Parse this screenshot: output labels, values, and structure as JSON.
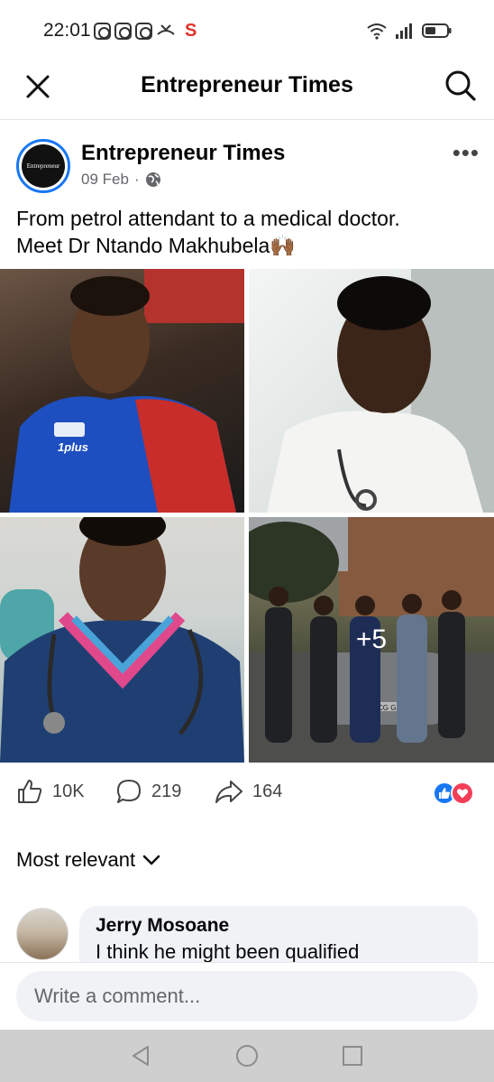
{
  "status_bar": {
    "time": "22:01",
    "left_icons": [
      "instagram-icon",
      "instagram-icon",
      "instagram-icon",
      "missed-call-icon",
      "s-app-icon"
    ],
    "s_label": "S",
    "right_icons": [
      "wifi-icon",
      "signal-icon",
      "battery-icon"
    ]
  },
  "app_bar": {
    "title": "Entrepreneur Times",
    "close_icon": "close-icon",
    "search_icon": "search-icon"
  },
  "post": {
    "page_name": "Entrepreneur Times",
    "avatar_text": "Entrepreneur",
    "date": "09 Feb",
    "separator": "·",
    "privacy_icon": "globe-icon",
    "more_label": "•••",
    "text_line1": "From petrol attendant to a medical doctor.",
    "text_line2": "Meet Dr Ntando Makhubela🙌🏾",
    "photos": [
      {
        "name": "photo-petrol-attendant",
        "badge": "1plus"
      },
      {
        "name": "photo-doctor-white-coat"
      },
      {
        "name": "photo-doctor-scrubs"
      },
      {
        "name": "photo-group-doctors",
        "plate": "CG GP"
      }
    ],
    "more_photos_label": "+5"
  },
  "reactions": {
    "likes": "10K",
    "comments": "219",
    "shares": "164",
    "reaction_types": [
      "like-icon",
      "love-icon"
    ],
    "colors": {
      "like": "#1877f2",
      "love": "#f33e58"
    }
  },
  "sort": {
    "label": "Most relevant"
  },
  "comment": {
    "author": "Jerry Mosoane",
    "text": "I think he might been qualified"
  },
  "composer": {
    "placeholder": "Write a comment..."
  }
}
